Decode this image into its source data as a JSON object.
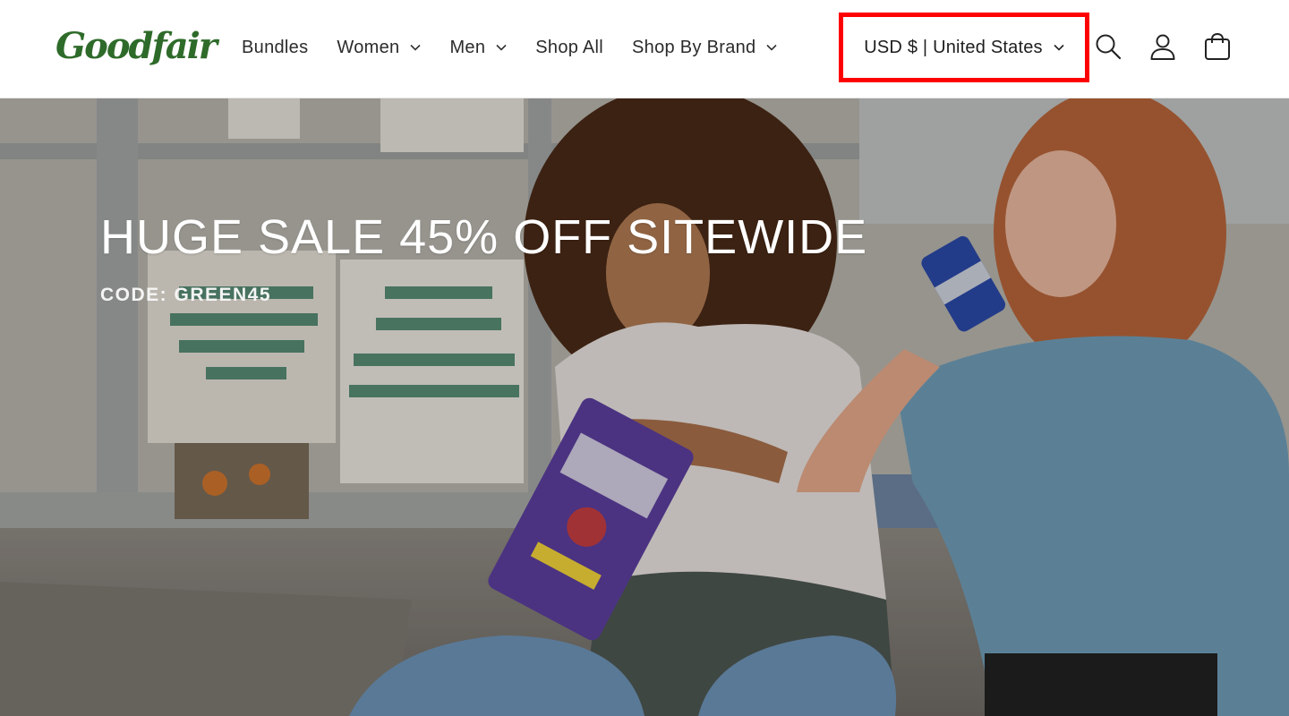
{
  "brand": {
    "logo_text": "Goodfair",
    "color": "#2e6b2a"
  },
  "nav": {
    "items": [
      {
        "label": "Bundles",
        "has_dropdown": false
      },
      {
        "label": "Women",
        "has_dropdown": true
      },
      {
        "label": "Men",
        "has_dropdown": true
      },
      {
        "label": "Shop All",
        "has_dropdown": false
      },
      {
        "label": "Shop By Brand",
        "has_dropdown": true
      }
    ]
  },
  "currency_selector": {
    "label": "USD $ | United States",
    "highlight_color": "#ff0000"
  },
  "header_icons": [
    "search-icon",
    "account-icon",
    "cart-icon"
  ],
  "hero": {
    "title": "HUGE SALE 45% OFF SITEWIDE",
    "code": "CODE: GREEN45"
  }
}
